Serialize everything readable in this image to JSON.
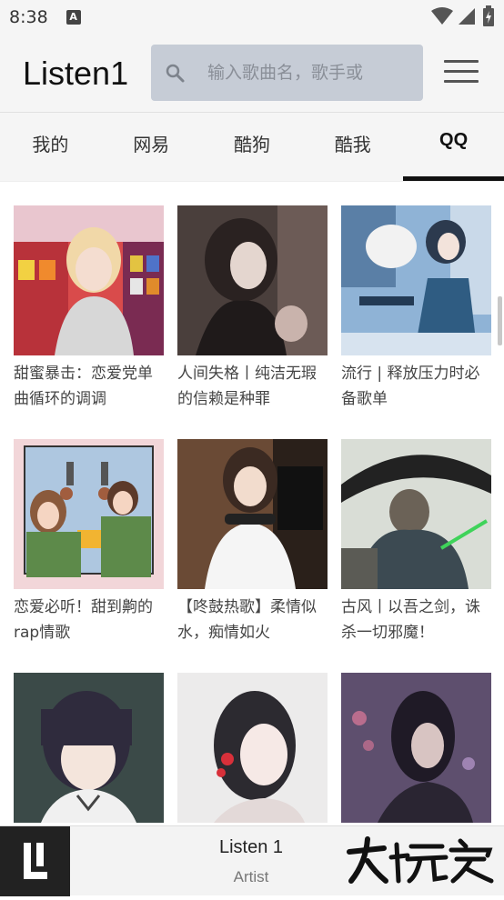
{
  "status": {
    "time": "8:38",
    "notif_icon": "A"
  },
  "app": {
    "title": "Listen1"
  },
  "search": {
    "placeholder": "输入歌曲名，歌手或"
  },
  "tabs": [
    {
      "label": "我的"
    },
    {
      "label": "网易"
    },
    {
      "label": "酷狗"
    },
    {
      "label": "酷我"
    },
    {
      "label": "QQ",
      "active": true
    }
  ],
  "playlists": [
    {
      "title": "甜蜜暴击：恋爱党单曲循环的调调"
    },
    {
      "title": "人间失格丨纯洁无瑕的信赖是种罪"
    },
    {
      "title": "流行 | 释放压力时必备歌单"
    },
    {
      "title": "恋爱必听！甜到齁的rap情歌"
    },
    {
      "title": "【咚鼓热歌】柔情似水，痴情如火"
    },
    {
      "title": "古风丨以吾之剑，诛杀一切邪魔！"
    },
    {
      "title": ""
    },
    {
      "title": ""
    },
    {
      "title": ""
    }
  ],
  "player": {
    "title": "Listen 1",
    "artist": "Artist"
  },
  "colors": {
    "background": "#f5f5f5",
    "search_bg": "#c6ccd6",
    "accent": "#111111"
  }
}
